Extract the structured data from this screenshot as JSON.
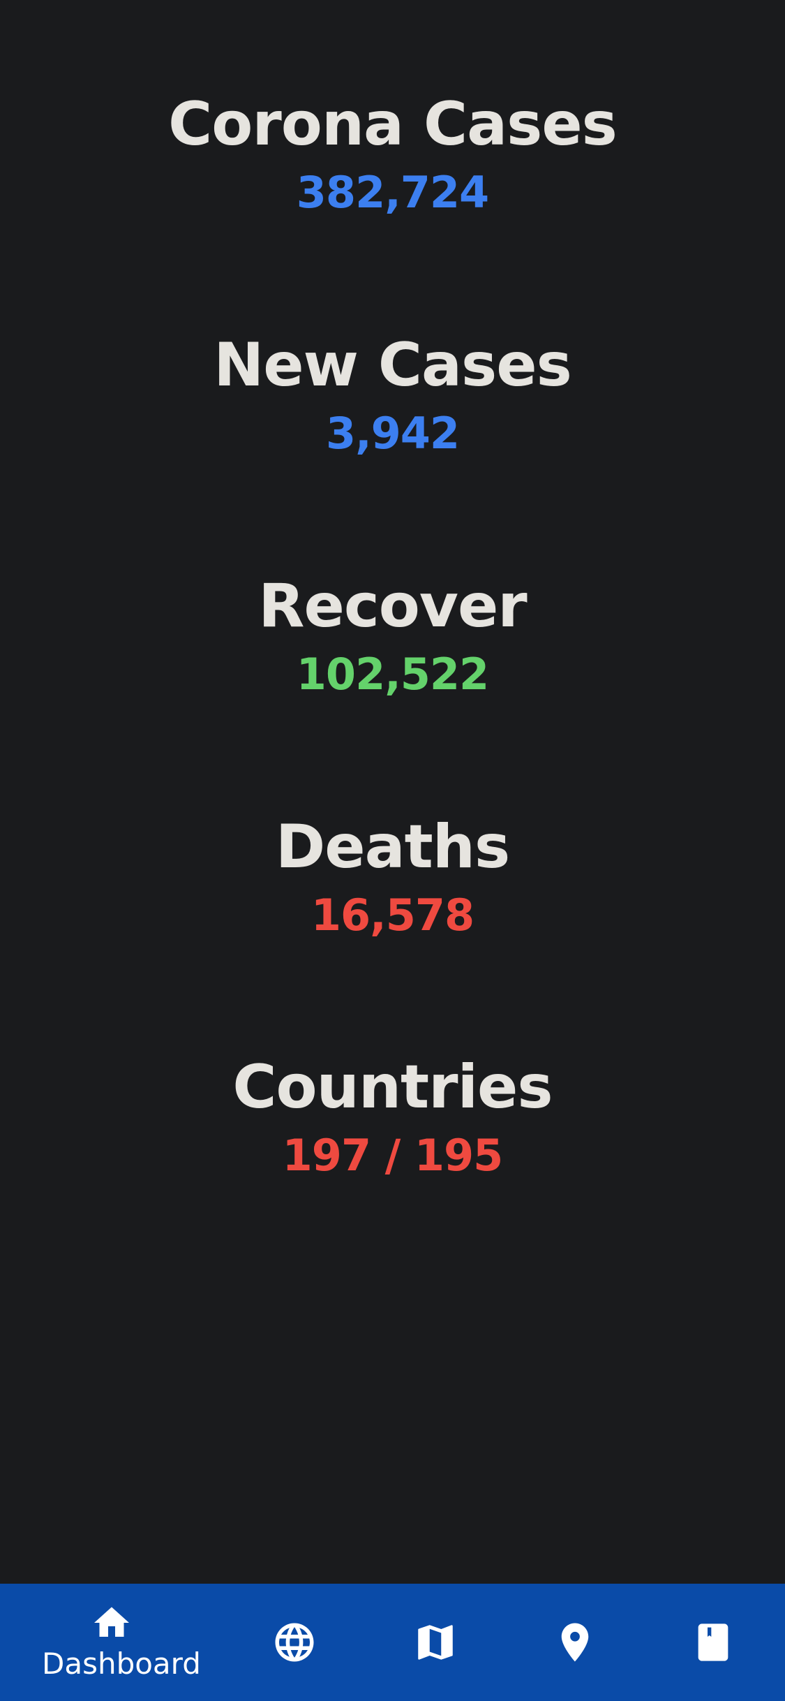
{
  "stats": [
    {
      "title": "Corona Cases",
      "value": "382,724",
      "color": "#3c7ff0"
    },
    {
      "title": "New Cases",
      "value": "3,942",
      "color": "#3c7ff0"
    },
    {
      "title": "Recover",
      "value": "102,522",
      "color": "#64d26b"
    },
    {
      "title": "Deaths",
      "value": "16,578",
      "color": "#ef4a40"
    },
    {
      "title": "Countries",
      "value": "197 / 195",
      "color": "#ef4a40"
    }
  ],
  "nav": {
    "background": "#0a4ba8",
    "items": [
      {
        "icon": "home-icon",
        "label": "Dashboard",
        "active": true
      },
      {
        "icon": "globe-icon",
        "label": "",
        "active": false
      },
      {
        "icon": "map-icon",
        "label": "",
        "active": false
      },
      {
        "icon": "location-pin-icon",
        "label": "",
        "active": false
      },
      {
        "icon": "bookmark-book-icon",
        "label": "",
        "active": false
      }
    ]
  }
}
